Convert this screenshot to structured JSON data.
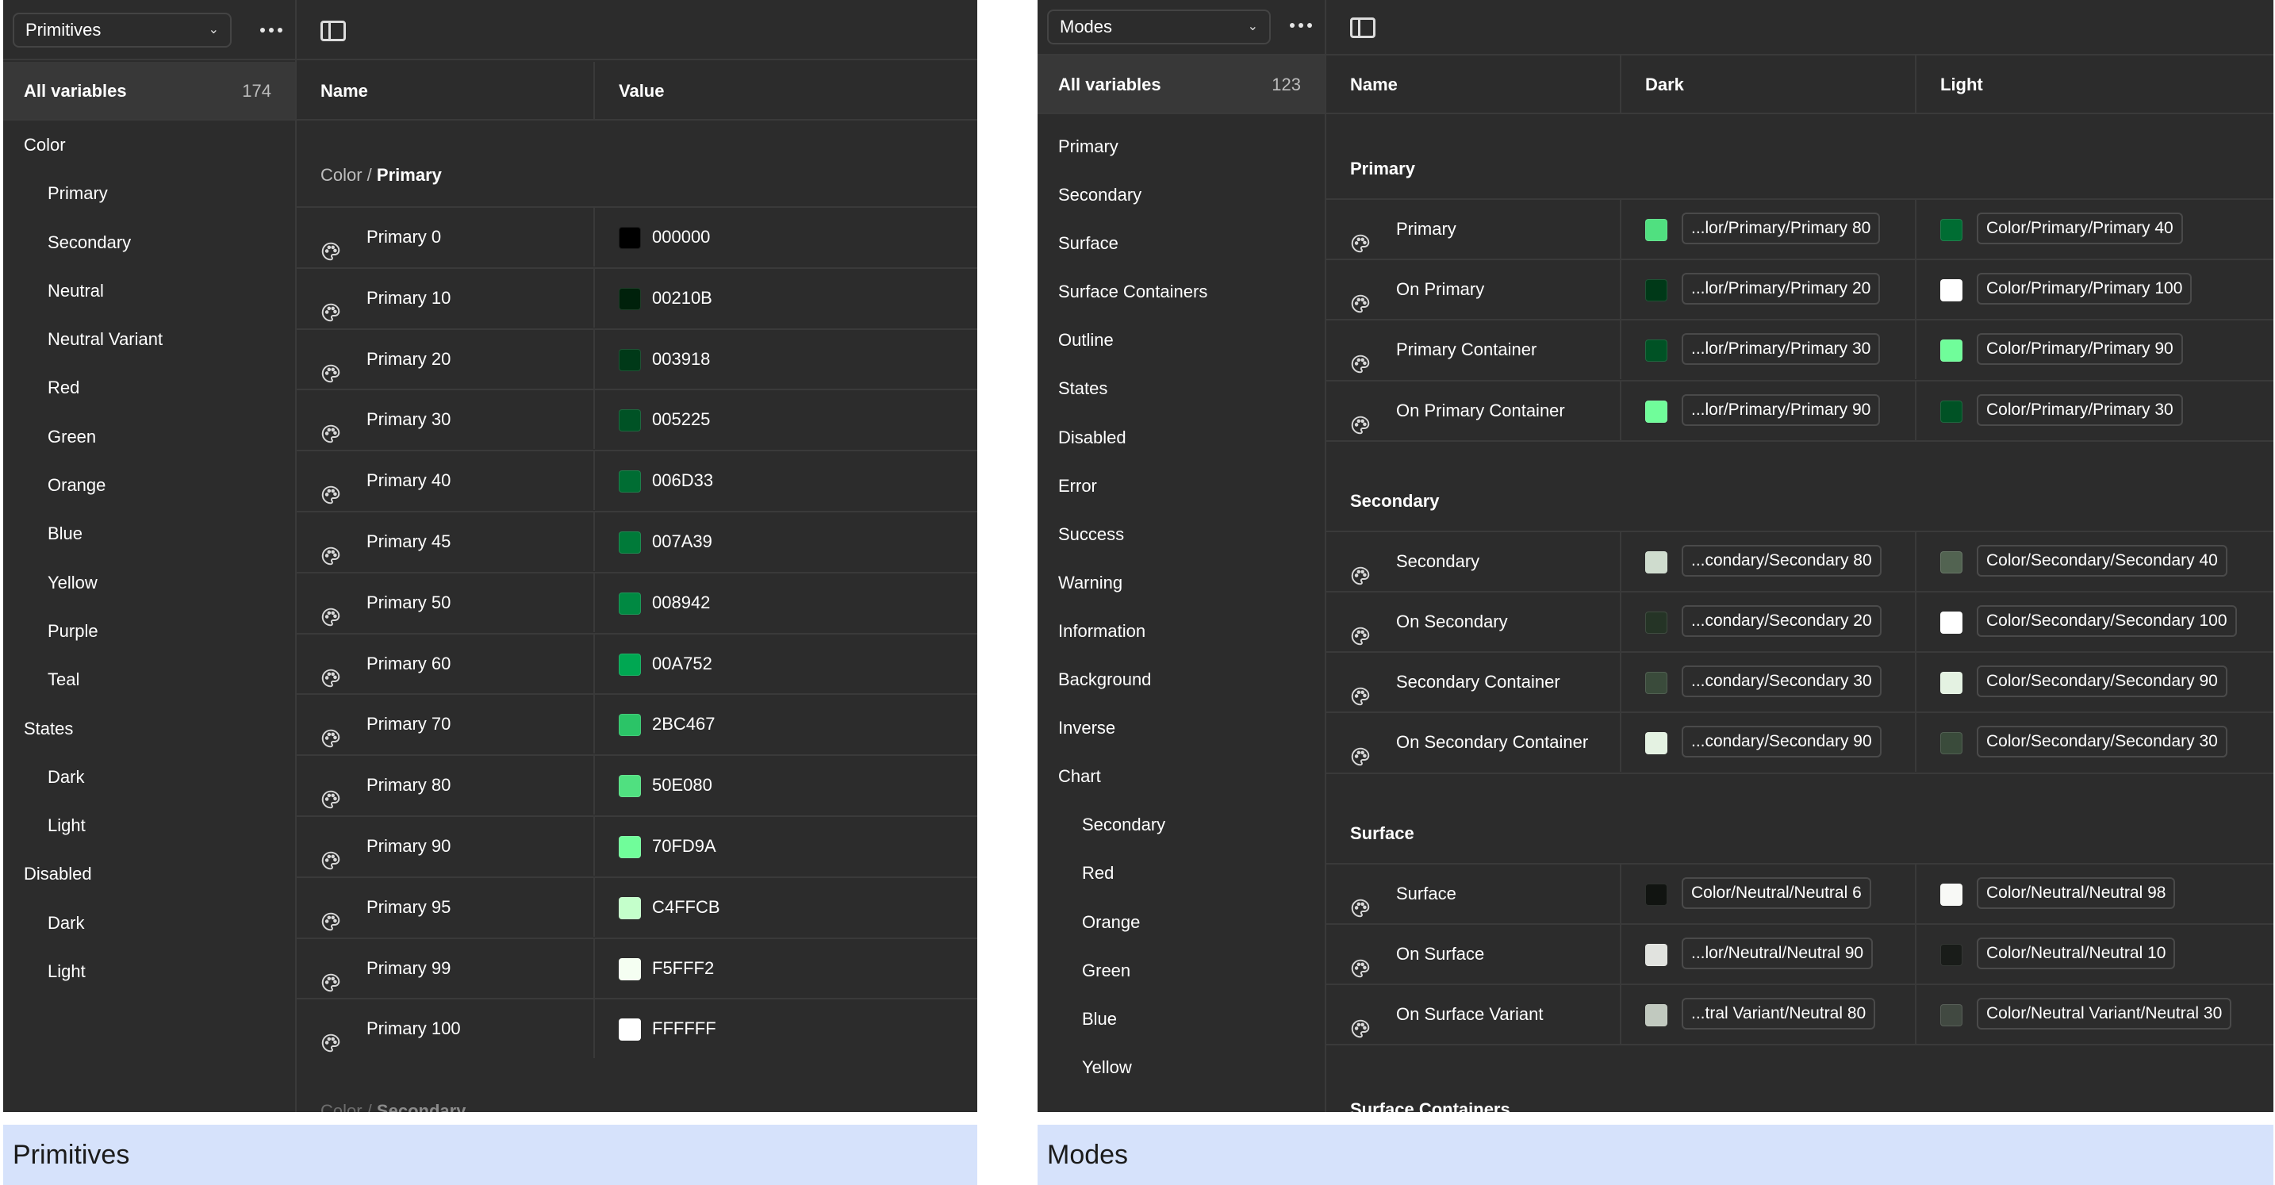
{
  "primitives": {
    "caption": "Primitives",
    "dropdown_label": "Primitives",
    "all_variables_label": "All variables",
    "all_variables_count": "174",
    "sidebar": [
      {
        "label": "Color",
        "child": false
      },
      {
        "label": "Primary",
        "child": true
      },
      {
        "label": "Secondary",
        "child": true
      },
      {
        "label": "Neutral",
        "child": true
      },
      {
        "label": "Neutral Variant",
        "child": true
      },
      {
        "label": "Red",
        "child": true
      },
      {
        "label": "Green",
        "child": true
      },
      {
        "label": "Orange",
        "child": true
      },
      {
        "label": "Blue",
        "child": true
      },
      {
        "label": "Yellow",
        "child": true
      },
      {
        "label": "Purple",
        "child": true
      },
      {
        "label": "Teal",
        "child": true
      },
      {
        "label": "States",
        "child": false
      },
      {
        "label": "Dark",
        "child": true
      },
      {
        "label": "Light",
        "child": true
      },
      {
        "label": "Disabled",
        "child": false
      },
      {
        "label": "Dark",
        "child": true
      },
      {
        "label": "Light",
        "child": true
      }
    ],
    "columns": {
      "name": "Name",
      "value": "Value"
    },
    "group_prefix": "Color / ",
    "group_name": "Primary",
    "next_group_prefix": "Color / ",
    "next_group_name": "Secondary",
    "rows": [
      {
        "name": "Primary 0",
        "hex": "000000",
        "color": "#000000"
      },
      {
        "name": "Primary 10",
        "hex": "00210B",
        "color": "#00210B"
      },
      {
        "name": "Primary 20",
        "hex": "003918",
        "color": "#003918"
      },
      {
        "name": "Primary 30",
        "hex": "005225",
        "color": "#005225"
      },
      {
        "name": "Primary 40",
        "hex": "006D33",
        "color": "#006D33"
      },
      {
        "name": "Primary 45",
        "hex": "007A39",
        "color": "#007A39"
      },
      {
        "name": "Primary 50",
        "hex": "008942",
        "color": "#008942"
      },
      {
        "name": "Primary 60",
        "hex": "00A752",
        "color": "#00A752"
      },
      {
        "name": "Primary 70",
        "hex": "2BC467",
        "color": "#2BC467"
      },
      {
        "name": "Primary 80",
        "hex": "50E080",
        "color": "#50E080"
      },
      {
        "name": "Primary 90",
        "hex": "70FD9A",
        "color": "#70FD9A"
      },
      {
        "name": "Primary 95",
        "hex": "C4FFCB",
        "color": "#C4FFCB"
      },
      {
        "name": "Primary 99",
        "hex": "F5FFF2",
        "color": "#F5FFF2"
      },
      {
        "name": "Primary 100",
        "hex": "FFFFFF",
        "color": "#FFFFFF"
      }
    ]
  },
  "modes": {
    "caption": "Modes",
    "dropdown_label": "Modes",
    "all_variables_label": "All variables",
    "all_variables_count": "123",
    "sidebar": [
      {
        "label": "Primary",
        "child": false
      },
      {
        "label": "Secondary",
        "child": false
      },
      {
        "label": "Surface",
        "child": false
      },
      {
        "label": "Surface Containers",
        "child": false
      },
      {
        "label": "Outline",
        "child": false
      },
      {
        "label": "States",
        "child": false
      },
      {
        "label": "Disabled",
        "child": false
      },
      {
        "label": "Error",
        "child": false
      },
      {
        "label": "Success",
        "child": false
      },
      {
        "label": "Warning",
        "child": false
      },
      {
        "label": "Information",
        "child": false
      },
      {
        "label": "Background",
        "child": false
      },
      {
        "label": "Inverse",
        "child": false
      },
      {
        "label": "Chart",
        "child": false
      },
      {
        "label": "Secondary",
        "child": true
      },
      {
        "label": "Red",
        "child": true
      },
      {
        "label": "Orange",
        "child": true
      },
      {
        "label": "Green",
        "child": true
      },
      {
        "label": "Blue",
        "child": true
      },
      {
        "label": "Yellow",
        "child": true
      }
    ],
    "columns": {
      "name": "Name",
      "dark": "Dark",
      "light": "Light"
    },
    "groups": [
      {
        "title": "Primary",
        "rows": [
          {
            "name": "Primary",
            "dark": "...lor/Primary/Primary 80",
            "dark_color": "#50E080",
            "light": "Color/Primary/Primary 40",
            "light_color": "#006D33"
          },
          {
            "name": "On Primary",
            "dark": "...lor/Primary/Primary 20",
            "dark_color": "#003918",
            "light": "Color/Primary/Primary 100",
            "light_color": "#FFFFFF"
          },
          {
            "name": "Primary Container",
            "dark": "...lor/Primary/Primary 30",
            "dark_color": "#005225",
            "light": "Color/Primary/Primary 90",
            "light_color": "#70FD9A"
          },
          {
            "name": "On Primary Container",
            "dark": "...lor/Primary/Primary 90",
            "dark_color": "#70FD9A",
            "light": "Color/Primary/Primary 30",
            "light_color": "#005225"
          }
        ]
      },
      {
        "title": "Secondary",
        "rows": [
          {
            "name": "Secondary",
            "dark": "...condary/Secondary 80",
            "dark_color": "#CFDCCE",
            "light": "Color/Secondary/Secondary 40",
            "light_color": "#526351"
          },
          {
            "name": "On Secondary",
            "dark": "...condary/Secondary 20",
            "dark_color": "#253426",
            "light": "Color/Secondary/Secondary 100",
            "light_color": "#FFFFFF"
          },
          {
            "name": "Secondary Container",
            "dark": "...condary/Secondary 30",
            "dark_color": "#3A4B3B",
            "light": "Color/Secondary/Secondary 90",
            "light_color": "#E4F2E2"
          },
          {
            "name": "On Secondary Container",
            "dark": "...condary/Secondary 90",
            "dark_color": "#E4F2E2",
            "light": "Color/Secondary/Secondary 30",
            "light_color": "#3A4B3B"
          }
        ]
      },
      {
        "title": "Surface",
        "rows": [
          {
            "name": "Surface",
            "dark": "Color/Neutral/Neutral 6",
            "dark_color": "#111411",
            "light": "Color/Neutral/Neutral 98",
            "light_color": "#F8F9F6"
          },
          {
            "name": "On Surface",
            "dark": "...lor/Neutral/Neutral 90",
            "dark_color": "#E1E3DF",
            "light": "Color/Neutral/Neutral 10",
            "light_color": "#191C19"
          },
          {
            "name": "On Surface Variant",
            "dark": "...tral Variant/Neutral 80",
            "dark_color": "#C1C9BF",
            "light": "Color/Neutral Variant/Neutral 30",
            "light_color": "#414941"
          }
        ]
      }
    ],
    "next_group_title": "Surface Containers"
  }
}
